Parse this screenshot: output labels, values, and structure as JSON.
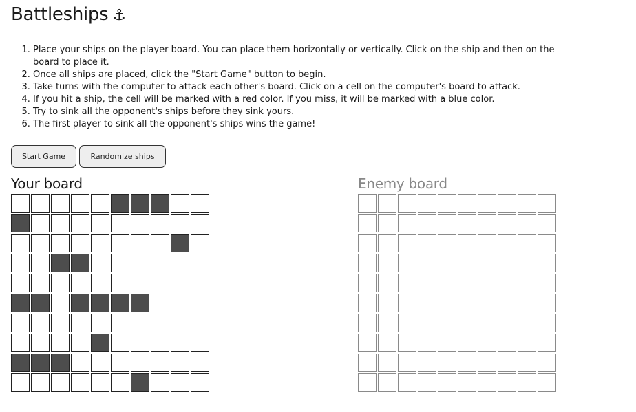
{
  "app": {
    "title": "Battleships",
    "title_icon": "⚓"
  },
  "instructions": [
    "Place your ships on the player board. You can place them horizontally or vertically. Click on the ship and then on the board to place it.",
    "Once all ships are placed, click the \"Start Game\" button to begin.",
    "Take turns with the computer to attack each other's board. Click on a cell on the computer's board to attack.",
    "If you hit a ship, the cell will be marked with a red color. If you miss, it will be marked with a blue color.",
    "Try to sink all the opponent's ships before they sink yours.",
    "The first player to sink all the opponent's ships wins the game!"
  ],
  "buttons": {
    "start_label": "Start Game",
    "randomize_label": "Randomize ships"
  },
  "player_board": {
    "title": "Your board",
    "rows": 10,
    "cols": 10,
    "grid": [
      [
        0,
        0,
        0,
        0,
        0,
        1,
        1,
        1,
        0,
        0
      ],
      [
        1,
        0,
        0,
        0,
        0,
        0,
        0,
        0,
        0,
        0
      ],
      [
        0,
        0,
        0,
        0,
        0,
        0,
        0,
        0,
        1,
        0
      ],
      [
        0,
        0,
        1,
        1,
        0,
        0,
        0,
        0,
        0,
        0
      ],
      [
        0,
        0,
        0,
        0,
        0,
        0,
        0,
        0,
        0,
        0
      ],
      [
        1,
        1,
        0,
        1,
        1,
        1,
        1,
        0,
        0,
        0
      ],
      [
        0,
        0,
        0,
        0,
        0,
        0,
        0,
        0,
        0,
        0
      ],
      [
        0,
        0,
        0,
        0,
        1,
        0,
        0,
        0,
        0,
        0
      ],
      [
        1,
        1,
        1,
        0,
        0,
        0,
        0,
        0,
        0,
        0
      ],
      [
        0,
        0,
        0,
        0,
        0,
        0,
        1,
        0,
        0,
        0
      ]
    ]
  },
  "enemy_board": {
    "title": "Enemy board",
    "rows": 10,
    "cols": 10
  },
  "colors": {
    "ship": "#4d4d4d",
    "cell_border": "#222222",
    "enemy_cell_border": "#8a8a8a",
    "enemy_title": "#888888",
    "button_bg": "#eeeeee"
  }
}
